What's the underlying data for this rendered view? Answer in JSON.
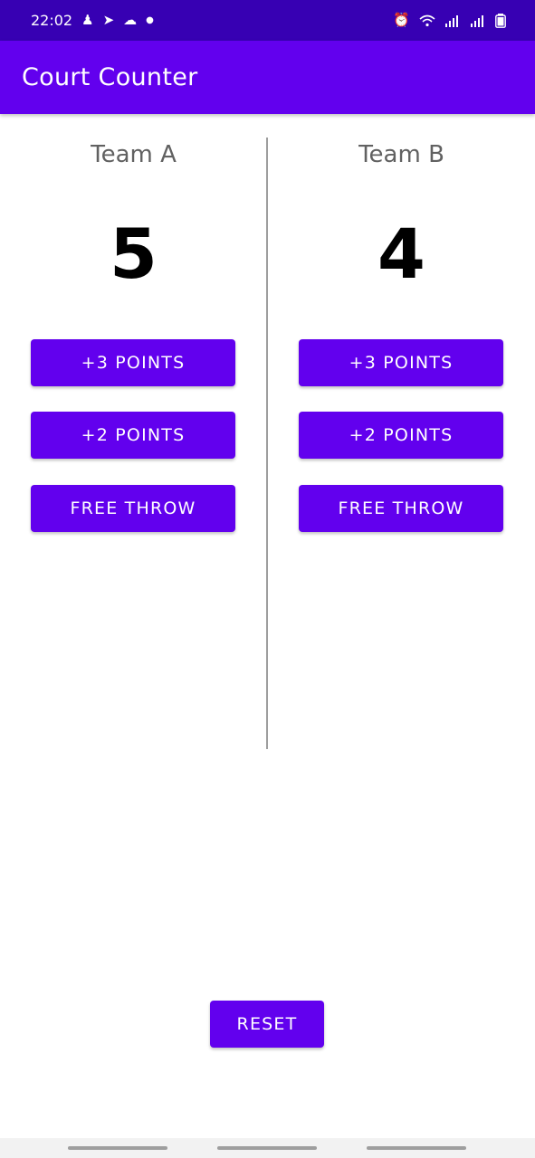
{
  "status_bar": {
    "time": "22:02",
    "left_icons": [
      "person-icon",
      "telegram-icon",
      "cloud-icon",
      "dot-icon"
    ],
    "right_icons": [
      "alarm-icon",
      "wifi-icon",
      "signal-icon",
      "signal-icon",
      "battery-icon"
    ],
    "background": "#3700B3"
  },
  "app_bar": {
    "title": "Court Counter",
    "background": "#6200EE"
  },
  "team_a": {
    "name": "Team A",
    "score": "5",
    "plus3_label": "+3 POINTS",
    "plus2_label": "+2 POINTS",
    "free_throw_label": "FREE THROW"
  },
  "team_b": {
    "name": "Team B",
    "score": "4",
    "plus3_label": "+3 POINTS",
    "plus2_label": "+2 POINTS",
    "free_throw_label": "FREE THROW"
  },
  "reset": {
    "label": "RESET"
  },
  "colors": {
    "accent": "#6200EE",
    "accent_dark": "#3700B3",
    "text_primary": "#000000",
    "text_secondary": "#616161"
  }
}
